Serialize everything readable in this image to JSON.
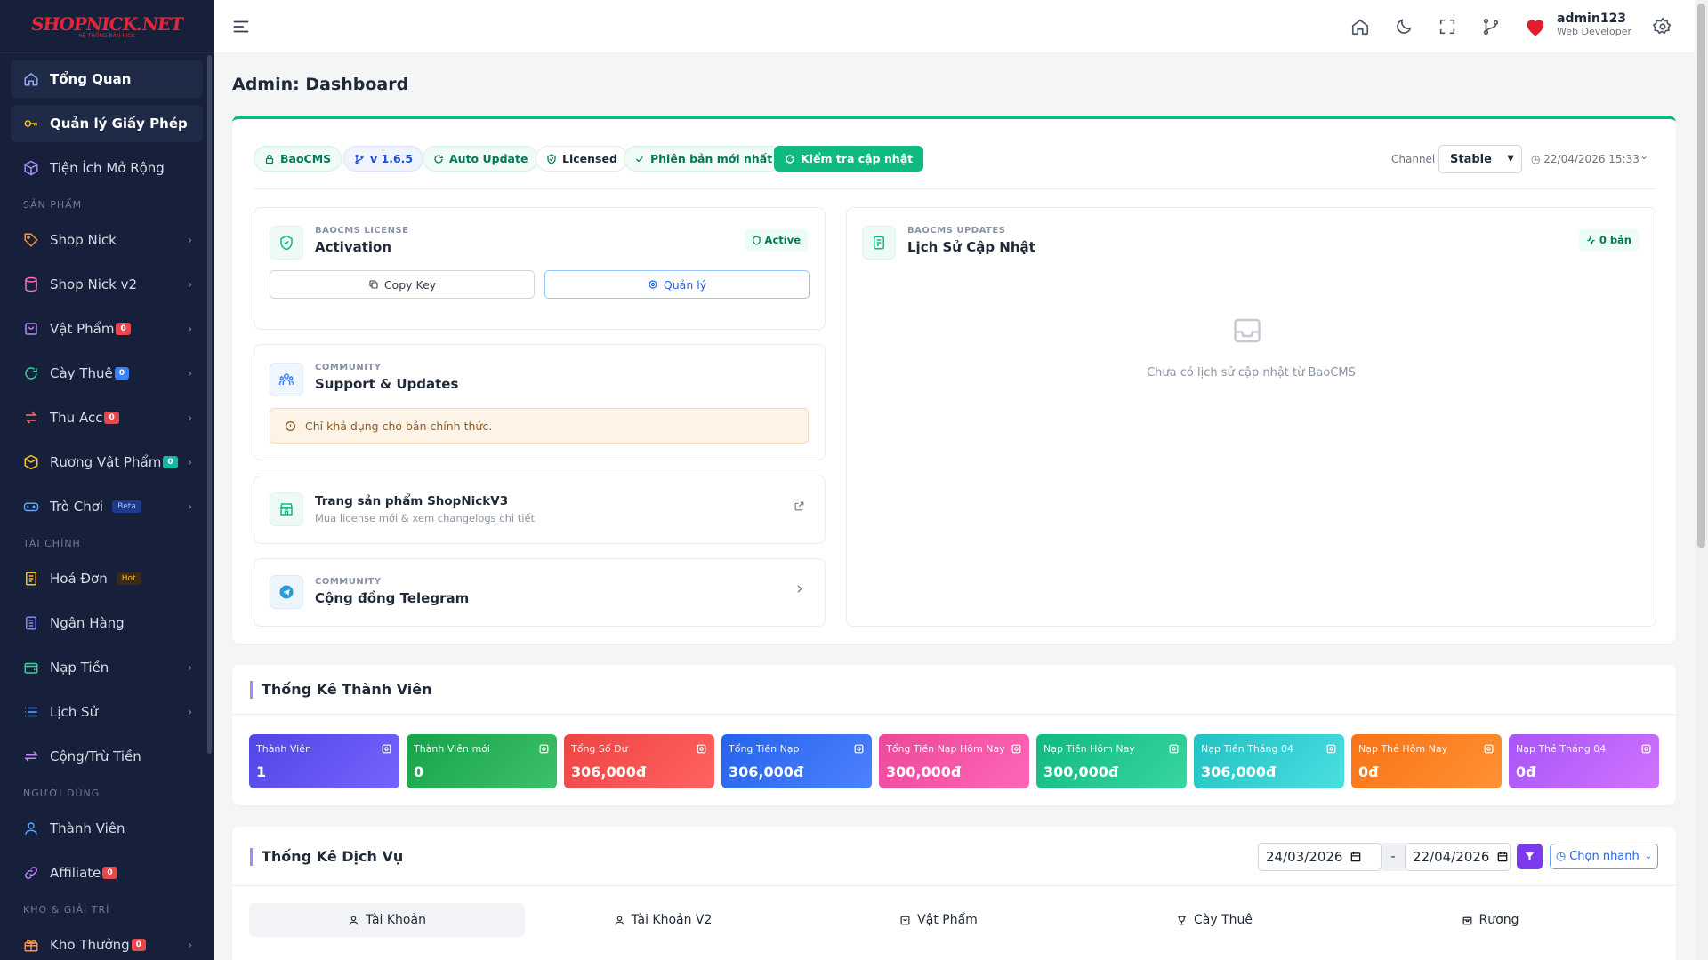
{
  "brand": {
    "logo_text": "SHOPNICK.NET",
    "logo_sub": "HỆ THỐNG BÁN NICK"
  },
  "sidebar": {
    "top_items": [
      {
        "label": "Tổng Quan",
        "icon": "home-icon"
      },
      {
        "label": "Quản lý Giấy Phép",
        "icon": "key-icon"
      },
      {
        "label": "Tiện Ích Mở Rộng",
        "icon": "cube-icon"
      }
    ],
    "sections": {
      "products": "SẢN PHẨM",
      "finance": "TÀI CHÍNH",
      "users": "NGƯỜI DÙNG",
      "rewards": "KHO & GIẢI TRÍ"
    },
    "product_items": [
      {
        "label": "Shop Nick"
      },
      {
        "label": "Shop Nick v2"
      },
      {
        "label": "Vật Phẩm",
        "badge": "0"
      },
      {
        "label": "Cày Thuê",
        "badge": "0"
      },
      {
        "label": "Thu Acc",
        "badge": "0"
      },
      {
        "label": "Rương Vật Phẩm",
        "badge": "0"
      },
      {
        "label": "Trò Chơi",
        "badge": "Beta"
      }
    ],
    "finance_items": [
      {
        "label": "Hoá Đơn",
        "badge": "Hot"
      },
      {
        "label": "Ngân Hàng"
      },
      {
        "label": "Nạp Tiền"
      },
      {
        "label": "Lịch Sử"
      },
      {
        "label": "Cộng/Trừ Tiền"
      }
    ],
    "user_items": [
      {
        "label": "Thành Viên"
      },
      {
        "label": "Affiliate",
        "badge": "0"
      }
    ],
    "reward_items": [
      {
        "label": "Kho Thưởng",
        "badge": "0"
      }
    ]
  },
  "topbar": {
    "user_name": "admin123",
    "user_role": "Web Developer"
  },
  "page": {
    "title": "Admin: Dashboard"
  },
  "license": {
    "chips": {
      "baocms": "BaoCMS",
      "version": "v 1.6.5",
      "auto_update": "Auto Update",
      "licensed": "Licensed",
      "latest": "Phiên bản mới nhất"
    },
    "check_button": "Kiểm tra cập nhật",
    "channel_label": "Channel",
    "channel_value": "Stable",
    "updated_at": "22/04/2026 15:33",
    "activation": {
      "kicker": "BAOCMS LICENSE",
      "title": "Activation",
      "status": "Active",
      "copy_key": "Copy Key",
      "manage": "Quản lý"
    },
    "community": {
      "kicker": "COMMUNITY",
      "title": "Support & Updates",
      "alert": "Chỉ khả dụng cho bản chính thức."
    },
    "product_link": {
      "title": "Trang sản phẩm ShopNickV3",
      "desc": "Mua license mới & xem changelogs chi tiết"
    },
    "telegram": {
      "kicker": "COMMUNITY",
      "title": "Cộng đồng Telegram"
    },
    "updates": {
      "kicker": "BAOCMS UPDATES",
      "title": "Lịch Sử Cập Nhật",
      "count": "0 bản",
      "empty": "Chưa có lịch sử cập nhật từ BaoCMS"
    }
  },
  "member_stats": {
    "title": "Thống Kê Thành Viên",
    "cards": [
      {
        "label": "Thành Viên",
        "value": "1",
        "color": "#4f46e5"
      },
      {
        "label": "Thành Viên mới",
        "value": "0",
        "color": "#16a34a"
      },
      {
        "label": "Tổng Số Dư",
        "value": "306,000đ",
        "color": "#ef4444"
      },
      {
        "label": "Tổng Tiền Nạp",
        "value": "306,000đ",
        "color": "#2563eb"
      },
      {
        "label": "Tổng Tiền Nạp Hôm Nay",
        "value": "300,000đ",
        "color": "#ec4899"
      },
      {
        "label": "Nạp Tiền Hôm Nay",
        "value": "300,000đ",
        "color": "#10b981"
      },
      {
        "label": "Nạp Tiền Tháng 04",
        "value": "306,000đ",
        "color": "#22c1c3"
      },
      {
        "label": "Nạp Thẻ Hôm Nay",
        "value": "0đ",
        "color": "#f97316"
      },
      {
        "label": "Nạp Thẻ Tháng 04",
        "value": "0đ",
        "color": "#a855f7"
      }
    ]
  },
  "service_stats": {
    "title": "Thống Kê Dịch Vụ",
    "date_from": "24/03/2026",
    "date_to": "22/04/2026",
    "date_sep": "-",
    "quick_select": "Chọn nhanh",
    "tabs": [
      "Tài Khoản",
      "Tài Khoản V2",
      "Vật Phẩm",
      "Cày Thuê",
      "Rương"
    ]
  }
}
